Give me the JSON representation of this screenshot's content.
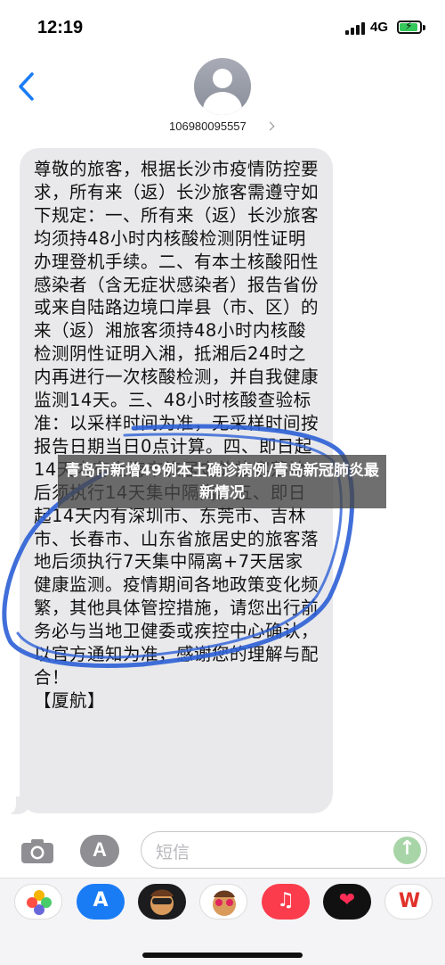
{
  "status_bar": {
    "time": "12:19",
    "network": "4G",
    "battery_icon": "battery-charging-icon"
  },
  "header": {
    "back_icon": "chevron-left-icon",
    "avatar_icon": "person-avatar-icon",
    "contact_number": "106980095557"
  },
  "message": {
    "text": "尊敬的旅客，根据长沙市疫情防控要求，所有来（返）长沙旅客需遵守如下规定：一、所有来（返）长沙旅客均须持48小时内核酸检测阴性证明办理登机手续。二、有本土核酸阳性感染者（含无症状感染者）报告省份或来自陆路边境口岸县（市、区）的来（返）湘旅客须持48小时内核酸检测阴性证明入湘，抵湘后24时之内再进行一次核酸检测，并自我健康监测14天。三、48小时核酸查验标准：以采样时间为准，无采样时间按报告日期当日0点计算。四、即日起14天内有上海市旅居史的旅客落地后须执行14天集中隔离。五、即日起14天内有深圳市、东莞市、吉林市、长春市、山东省旅居史的旅客落地后须执行7天集中隔离+7天居家健康监测。疫情期间各地政策变化频繁，其他具体管控措施，请您出行前务必与当地卫健委或疾控中心确认，以官方通知为准，感谢您的理解与配合！\n【厦航】"
  },
  "overlay": {
    "headline": "青岛市新增49例本土确诊病例/青岛新冠肺炎最新情况"
  },
  "compose": {
    "camera_icon": "camera-icon",
    "apps_icon": "app-store-icon",
    "placeholder": "短信",
    "send_icon": "arrow-up-icon"
  },
  "app_drawer": {
    "apps": [
      "photos-icon",
      "app-store-icon",
      "memoji-icon",
      "memoji-hearts-icon",
      "music-icon",
      "digital-touch-icon",
      "wps-icon"
    ]
  },
  "colors": {
    "bubble": "#e9e9eb",
    "accent_blue": "#1a7cf5",
    "send_green": "#a8d5a7",
    "scribble_blue": "#2c5fd6"
  }
}
